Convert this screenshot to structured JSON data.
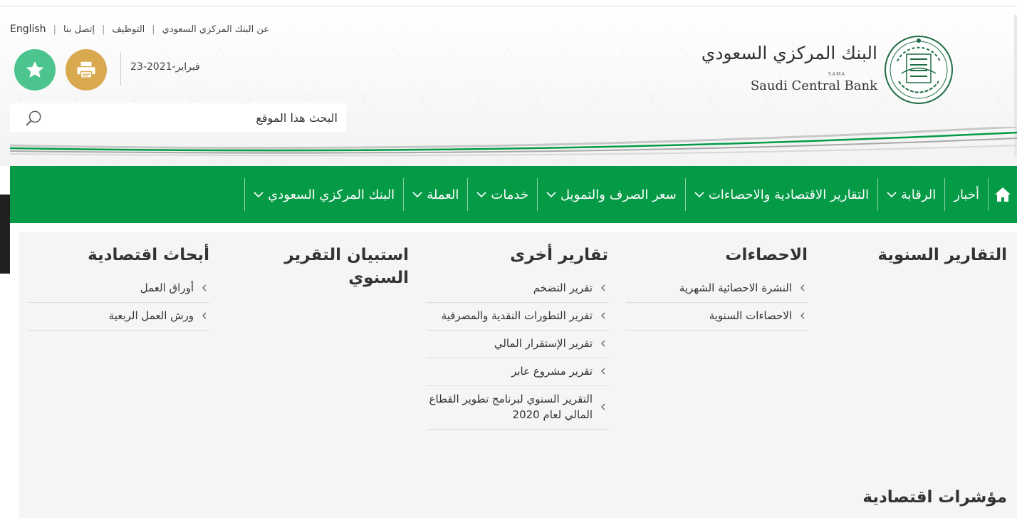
{
  "util_links": {
    "english": "English",
    "contact": "إتصل بنا",
    "careers": "التوظيف",
    "about": "عن البنك المركزي السعودي"
  },
  "date": "23-فبراير-2021",
  "search": {
    "placeholder": "البحث هذا الموقع"
  },
  "logo": {
    "arabic": "البنك المركزي السعودي",
    "sama": "SAMA",
    "english": "Saudi Central Bank"
  },
  "nav": {
    "items": [
      {
        "label": "أخبار",
        "dropdown": false
      },
      {
        "label": "الرقابة",
        "dropdown": true
      },
      {
        "label": "التقارير الاقتصادية والاحصاءات",
        "dropdown": true
      },
      {
        "label": "سعر الصرف والتمويل",
        "dropdown": true
      },
      {
        "label": "خدمات",
        "dropdown": true
      },
      {
        "label": "العملة",
        "dropdown": true
      },
      {
        "label": "البنك المركزي السعودي",
        "dropdown": true
      }
    ]
  },
  "mega": {
    "columns": [
      {
        "title": "التقارير السنوية",
        "items": []
      },
      {
        "title": "الاحصاءات",
        "items": [
          "النشرة الاحصائية الشهرية",
          "الاحصاءات السنوية"
        ]
      },
      {
        "title": "تقارير أخرى",
        "items": [
          "تقرير التضخم",
          "تقرير التطورات النقدية والمصرفية",
          "تقرير الإستقرار المالي",
          "تقرير مشروع عابر",
          "التقرير السنوي لبرنامج تطوير القطاع المالي لعام 2020"
        ]
      },
      {
        "title": "استبيان التقرير السنوي",
        "items": []
      },
      {
        "title": "أبحاث اقتصادية",
        "items": [
          "أوراق العمل",
          "ورش العمل الربعية"
        ]
      }
    ],
    "bottom_title": "مؤشرات اقتصادية"
  },
  "colors": {
    "nav_green": "#049a46",
    "favorite": "#4cc48d",
    "print": "#d9a94f",
    "seal_green": "#1f6e44"
  }
}
